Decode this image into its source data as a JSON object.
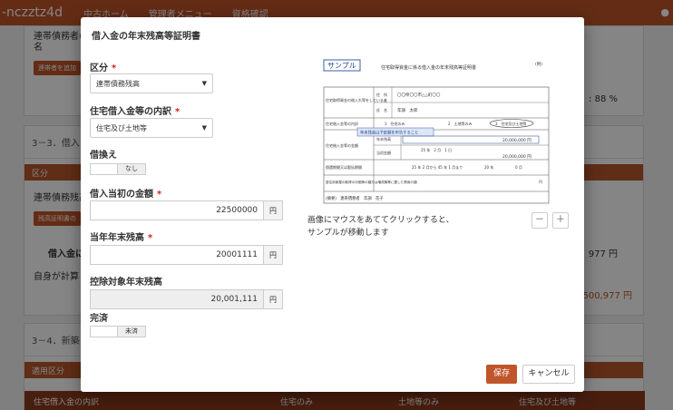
{
  "topbar": {
    "user": "-nczztz4d",
    "nav": [
      "中古ホーム",
      "管理者メニュー",
      "資格確認"
    ]
  },
  "background": {
    "cut_text_1": "連帯債務者の",
    "cut_text_2": "名",
    "p1_button": "連帯者を追加",
    "percent": ": 88 %",
    "section_3_3": "3－3．借入",
    "bar_label": "区分",
    "row_label": "連帯債務残高",
    "small_button": "残高証明書の",
    "loan_label": "借入金に",
    "amount_right": "977 円",
    "self_calc": "自身が計算し",
    "amount_right2": "500,977 円",
    "section_3_4": "3－4．新築",
    "bar2_label": "適用区分",
    "bottom_row": [
      "住宅借入金の内訳",
      "住宅のみ",
      "土地等のみ",
      "住宅及び土地等"
    ],
    "side_btn": "保存"
  },
  "modal": {
    "title": "借入金の年末残高等証明書",
    "category_label": "区分",
    "category_value": "連帯債務残高",
    "loan_type_label": "住宅借入金等の内訳",
    "loan_type_value": "住宅及び土地等",
    "refinance_label": "借換え",
    "refinance_value": "なし",
    "initial_amount_label": "借入当初の金額",
    "initial_amount_value": "22500000",
    "current_balance_label": "当年年末残高",
    "current_balance_value": "20001111",
    "deduction_balance_label": "控除対象年末残高",
    "deduction_balance_value": "20,001,111",
    "unit": "円",
    "complete_label": "完済",
    "complete_value": "未済",
    "hint_line1": "画像にマウスをあててクリックすると、",
    "hint_line2": "サンプルが移動します",
    "zoom_out": "－",
    "zoom_in": "＋",
    "save": "保存",
    "cancel": "キャンセル"
  },
  "sample": {
    "tag": "サンプル",
    "doc_title": "住宅取得資金に係る借入金の年末残高等証明書",
    "stamp": "(例)",
    "row1_label": "住宅取得資金の借入れ等をしている者",
    "name_key": "氏　名",
    "name_value": "年調　太郎",
    "addr_key": "住　所",
    "addr_value": "〇〇県〇〇市△△町〇〇",
    "row2_label": "住宅借入金等の内訳",
    "opt1": "1　住宅のみ",
    "opt2": "2　土地等のみ",
    "opt3": "3　住宅及び土地等",
    "callout": "年末残高は予定額を申告すること",
    "row3_label": "住宅借入金等の金額",
    "balance_key": "年末残高",
    "balance_value": "20,000,000 円",
    "initial_key": "当初金額",
    "initial_value": "20,000,000 円",
    "date_line": "25 年　2 月　1 日",
    "row4_label": "償還期間又は賦払期間",
    "period_line": "25 年 2 月から 45 年 1 月まで",
    "period_years": "20 年",
    "period_months": "0 月",
    "row5_label": "居住用家屋の取得の対価等の額又は増改築等に要した費用の額",
    "row5_unit": "円",
    "lender": "(摘要)　連帯債務者　年調　花子"
  },
  "colors": {
    "accent": "#c0552a",
    "required": "#d02020"
  }
}
